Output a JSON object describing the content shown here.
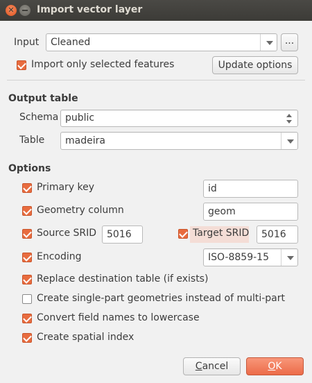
{
  "window": {
    "title": "Import vector layer"
  },
  "input": {
    "label": "Input",
    "value": "Cleaned",
    "browse_label": "...",
    "import_selected_label": "Import only selected features",
    "import_selected_checked": true,
    "update_label": "Update options"
  },
  "output_table": {
    "title": "Output table",
    "schema_label": "Schema",
    "schema_value": "public",
    "table_label": "Table",
    "table_value": "madeira"
  },
  "options": {
    "title": "Options",
    "primary_key": {
      "label": "Primary key",
      "checked": true,
      "value": "id"
    },
    "geometry_column": {
      "label": "Geometry column",
      "checked": true,
      "value": "geom"
    },
    "source_srid": {
      "label": "Source SRID",
      "checked": true,
      "value": "5016"
    },
    "target_srid": {
      "label": "Target SRID",
      "checked": true,
      "value": "5016"
    },
    "encoding": {
      "label": "Encoding",
      "checked": true,
      "value": "ISO-8859-15"
    },
    "replace_table": {
      "label": "Replace destination table (if exists)",
      "checked": true
    },
    "single_part": {
      "label": "Create single-part geometries instead of multi-part",
      "checked": false
    },
    "lowercase": {
      "label": "Convert field names to lowercase",
      "checked": true
    },
    "spatial_index": {
      "label": "Create spatial index",
      "checked": true
    }
  },
  "buttons": {
    "cancel_label": "Cancel",
    "ok_label": "OK"
  },
  "colors": {
    "accent": "#e86c3f",
    "title_bar": "#3c3b37"
  }
}
